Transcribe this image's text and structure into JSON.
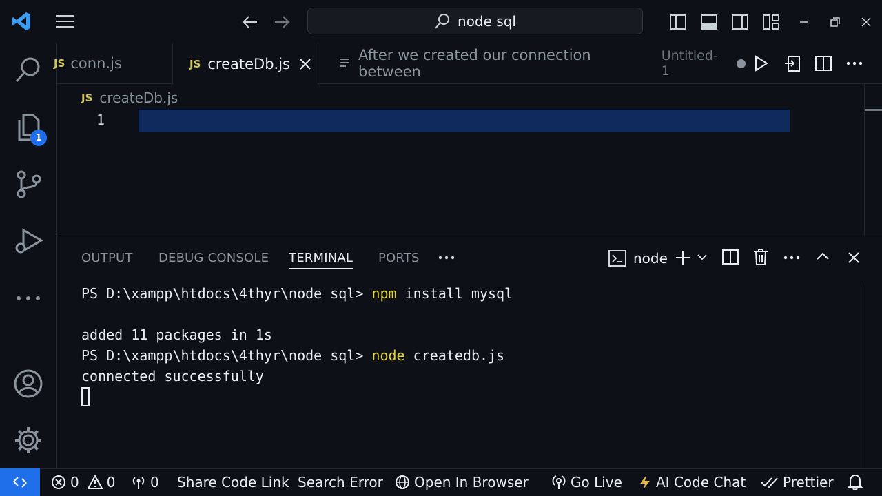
{
  "search": {
    "text": "node sql"
  },
  "activitybar": {
    "explorer_badge": "1"
  },
  "tabs": [
    {
      "label": "conn.js",
      "glyph": "JS"
    },
    {
      "label": "createDb.js",
      "glyph": "JS"
    },
    {
      "label": "After we created our connection between",
      "suffix": "Untitled-1"
    }
  ],
  "breadcrumb": {
    "glyph": "JS",
    "file": "createDb.js"
  },
  "editor": {
    "line_number": "1"
  },
  "panel": {
    "tabs": [
      "OUTPUT",
      "DEBUG CONSOLE",
      "TERMINAL",
      "PORTS"
    ],
    "active_tab": "TERMINAL",
    "terminal_profile": "node"
  },
  "terminal": {
    "line1_prompt": "PS D:\\xampp\\htdocs\\4thyr\\node sql> ",
    "line1_cmd": "npm",
    "line1_rest": " install mysql",
    "line2": "added 11 packages in 1s",
    "line3_prompt": "PS D:\\xampp\\htdocs\\4thyr\\node sql> ",
    "line3_cmd": "node",
    "line3_rest": " createdb.js",
    "line4": "connected successfully"
  },
  "statusbar": {
    "errors": "0",
    "warnings": "0",
    "ports": "0",
    "share": "Share Code Link",
    "search_error": "Search Error",
    "open_browser": "Open In Browser",
    "go_live": "Go Live",
    "ai_chat": "AI Code Chat",
    "prettier": "Prettier"
  },
  "colors": {
    "accent": "#1f6feb",
    "js_yellow": "#d2c45b",
    "cmd_yellow": "#e3d43a"
  }
}
